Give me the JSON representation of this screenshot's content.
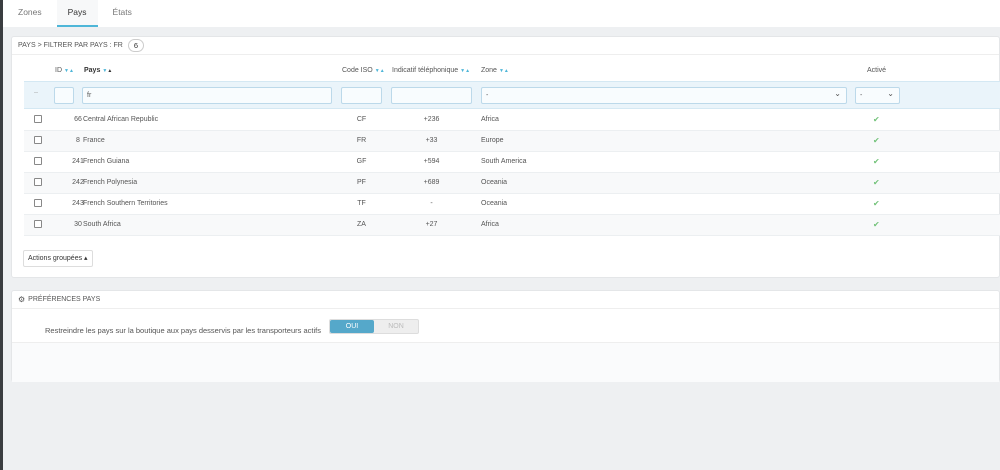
{
  "tabs": [
    {
      "label": "Zones"
    },
    {
      "label": "Pays"
    },
    {
      "label": "États"
    }
  ],
  "list": {
    "title": "Pays > Filtrer par pays : fr",
    "count": "6",
    "columns": {
      "id": "ID",
      "country": "Pays",
      "iso": "Code ISO",
      "call_prefix": "Indicatif téléphonique",
      "zone": "Zone",
      "active": "Activé"
    },
    "filters": {
      "reset": "--",
      "id": "",
      "country": "fr",
      "iso": "",
      "call_prefix": "",
      "zone": "-",
      "active": "-"
    },
    "rows": [
      {
        "id": "66",
        "country": "Central African Republic",
        "iso": "CF",
        "prefix": "+236",
        "zone": "Africa",
        "active": "✔"
      },
      {
        "id": "8",
        "country": "France",
        "iso": "FR",
        "prefix": "+33",
        "zone": "Europe",
        "active": "✔"
      },
      {
        "id": "241",
        "country": "French Guiana",
        "iso": "GF",
        "prefix": "+594",
        "zone": "South America",
        "active": "✔"
      },
      {
        "id": "242",
        "country": "French Polynesia",
        "iso": "PF",
        "prefix": "+689",
        "zone": "Oceania",
        "active": "✔"
      },
      {
        "id": "243",
        "country": "French Southern Territories",
        "iso": "TF",
        "prefix": "-",
        "zone": "Oceania",
        "active": "✔"
      },
      {
        "id": "30",
        "country": "South Africa",
        "iso": "ZA",
        "prefix": "+27",
        "zone": "Africa",
        "active": "✔"
      }
    ],
    "bulk_label": "Actions groupées ▴"
  },
  "prefs": {
    "title": "Préférences pays",
    "label": "Restreindre les pays sur la boutique aux pays desservis par les transporteurs actifs",
    "yes": "OUI",
    "no": "NON",
    "value": "yes"
  },
  "colors": {
    "accent": "#4eb6d8",
    "toggle_on": "#55a8ca",
    "check": "#72c279"
  }
}
